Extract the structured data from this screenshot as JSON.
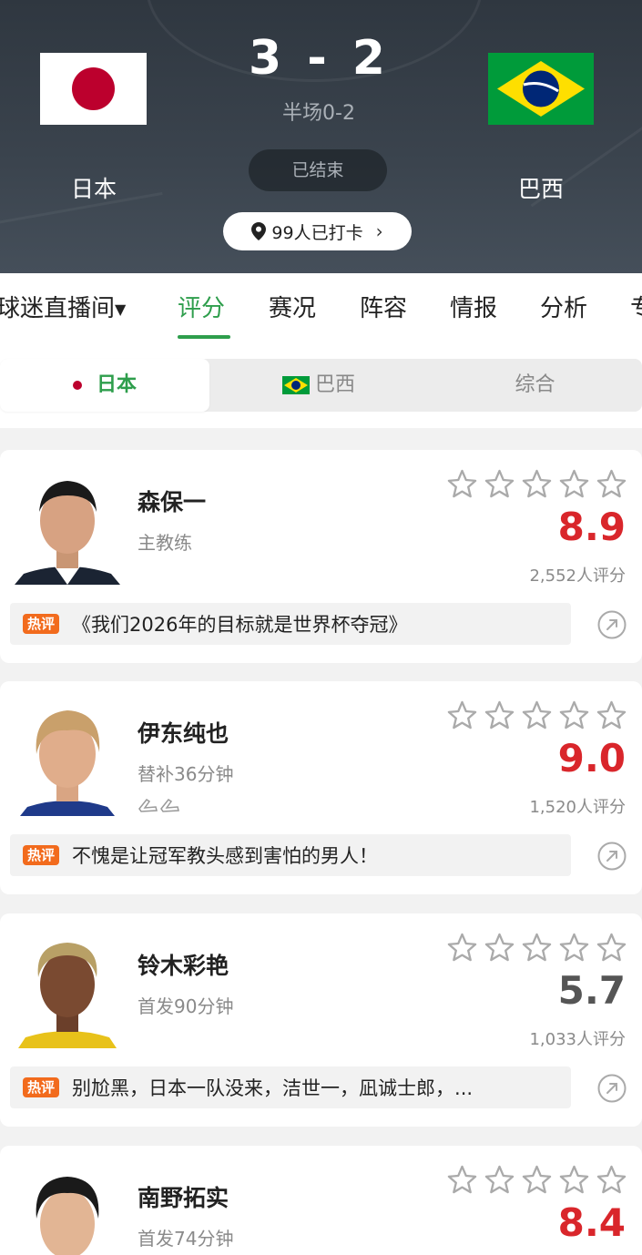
{
  "match": {
    "home_team": "日本",
    "away_team": "巴西",
    "home_score": "3",
    "away_score": "2",
    "separator": "-",
    "halftime": "半场0-2",
    "status": "已结束",
    "checkin": "99人已打卡"
  },
  "tabs": {
    "live_room": "球迷直播间",
    "rating": "评分",
    "events": "赛况",
    "lineup": "阵容",
    "intel": "情报",
    "analysis": "分析",
    "partial": "专"
  },
  "segment": {
    "home": "日本",
    "away": "巴西",
    "overall": "综合"
  },
  "players": [
    {
      "name": "森保一",
      "role": "主教练",
      "rating": "8.9",
      "count": "2,552人评分",
      "comment_badge": "热评",
      "comment": "《我们2026年的目标就是世界杯夺冠》"
    },
    {
      "name": "伊东纯也",
      "role": "替补36分钟",
      "rating": "9.0",
      "count": "1,520人评分",
      "comment_badge": "热评",
      "comment": "不愧是让冠军教头感到害怕的男人！"
    },
    {
      "name": "铃木彩艳",
      "role": "首发90分钟",
      "rating": "5.7",
      "count": "1,033人评分",
      "comment_badge": "热评",
      "comment": "别尬黑，日本一队没来，洁世一，凪诚士郎，..."
    },
    {
      "name": "南野拓实",
      "role": "首发74分钟",
      "rating": "8.4",
      "count": "",
      "comment_badge": "",
      "comment": ""
    }
  ],
  "colors": {
    "accent_green": "#2e9e4c",
    "rating_red": "#d9262b",
    "hot_orange": "#f26b1d",
    "header_bg": "#3b444e"
  },
  "icons": {
    "star": "star-outline-icon",
    "share": "share-icon",
    "pin": "location-pin-icon",
    "chevron": "chevron-right-icon",
    "boots": "boots-icon"
  }
}
